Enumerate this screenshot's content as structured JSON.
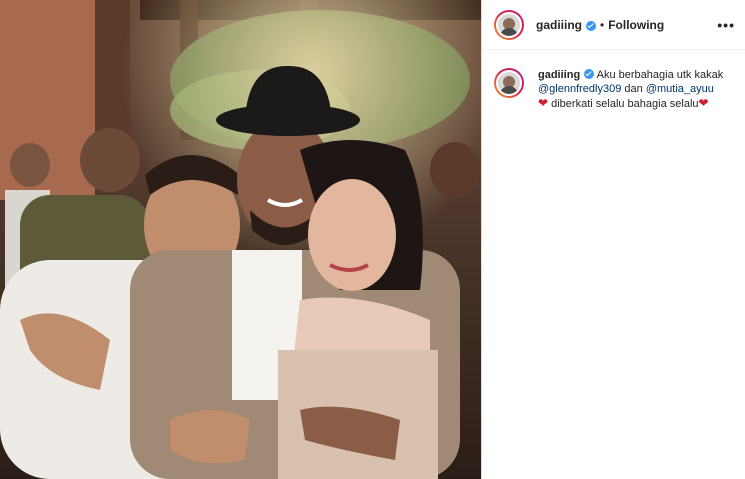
{
  "post": {
    "username": "gadiiing",
    "separator": "•",
    "follow_status": "Following",
    "more_icon": "•••",
    "caption": {
      "username": "gadiiing",
      "text_1": "Aku berbahagia utk kakak",
      "mention_1": "@glennfredly309",
      "text_2": "dan",
      "mention_2": "@mutia_ayuu",
      "heart_1": "❤",
      "text_3": "diberkati selalu bahagia selalu",
      "heart_2": "❤"
    }
  },
  "colors": {
    "verified_badge": "#3897f0",
    "mention": "#003569",
    "heart": "#d01e2f"
  }
}
